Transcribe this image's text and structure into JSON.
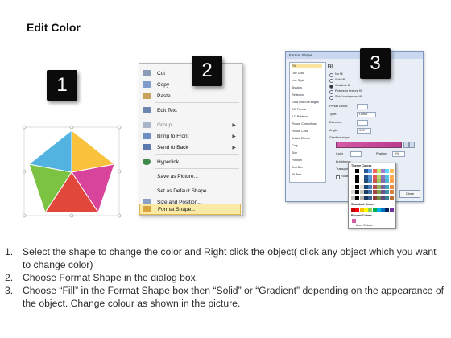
{
  "page": {
    "title": "Edit Color"
  },
  "steps": [
    "1",
    "2",
    "3"
  ],
  "context_menu": {
    "items": [
      {
        "label": "Cut",
        "icon": "scissors-icon",
        "submenu": false
      },
      {
        "label": "Copy",
        "icon": "copy-icon",
        "submenu": false
      },
      {
        "label": "Paste",
        "icon": "paste-icon",
        "submenu": false
      },
      {
        "label": "Edit Text",
        "icon": "edit-text-icon",
        "submenu": false
      },
      {
        "label": "Group",
        "icon": "group-icon",
        "submenu": true
      },
      {
        "label": "Bring to Front",
        "icon": "bring-front-icon",
        "submenu": true
      },
      {
        "label": "Send to Back",
        "icon": "send-back-icon",
        "submenu": true
      },
      {
        "label": "Hyperlink...",
        "icon": "hyperlink-icon",
        "submenu": false
      },
      {
        "label": "Save as Picture...",
        "icon": "",
        "submenu": false
      },
      {
        "label": "Set as Default Shape",
        "icon": "",
        "submenu": false
      },
      {
        "label": "Size and Position...",
        "icon": "size-icon",
        "submenu": false
      },
      {
        "label": "Format Shape...",
        "icon": "format-shape-icon",
        "submenu": false,
        "highlighted": true
      }
    ]
  },
  "format_dialog": {
    "title": "Format Shape",
    "nav": [
      "Fill",
      "Line Color",
      "Line Style",
      "Shadow",
      "Reflection",
      "Glow and Soft Edges",
      "3-D Format",
      "3-D Rotation",
      "Picture Corrections",
      "Picture Color",
      "Artistic Effects",
      "Crop",
      "Size",
      "Position",
      "Text Box",
      "Alt Text"
    ],
    "section": "Fill",
    "fill_options": [
      "No fill",
      "Solid fill",
      "Gradient fill",
      "Picture or texture fill",
      "Slide background fill"
    ],
    "fields": {
      "preset": "Preset colors:",
      "type_label": "Type:",
      "type_value": "Linear",
      "direction": "Direction:",
      "angle_label": "Angle:",
      "angle_value": "315°",
      "stops": "Gradient stops",
      "color": "Color",
      "position_label": "Position:",
      "position_value": "0%",
      "brightness": "Brightness:",
      "transparency": "Transparency:",
      "rotate": "Rotate with shape"
    },
    "close_label": "Close",
    "palette": {
      "theme": "Theme Colors",
      "standard": "Standard Colors",
      "recent": "Recent Colors",
      "more": "More Colors..."
    }
  },
  "instructions": [
    {
      "num": "1.",
      "text": "Select the shape to change the color and Right click the object( click any object which you want to change color)"
    },
    {
      "num": "2.",
      "text": "Choose Format Shape in the dialog box."
    },
    {
      "num": "3.",
      "text": "Choose “Fill” in the Format Shape box then “Solid” or “Gradient” depending on the appearance of the object. Change colour as shown in the picture."
    }
  ],
  "colors": {
    "pentagon": [
      "#f9c23c",
      "#d8439b",
      "#e2473c",
      "#7cc243",
      "#53b3e0"
    ],
    "highlight": "#fbe9a6",
    "accent_gradient": "#d55aa8"
  }
}
